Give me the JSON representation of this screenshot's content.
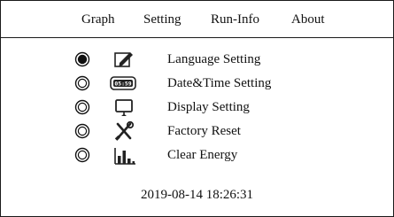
{
  "menu": {
    "items": [
      {
        "label": "Graph"
      },
      {
        "label": "Setting"
      },
      {
        "label": "Run-Info"
      },
      {
        "label": "About"
      }
    ]
  },
  "settings": {
    "items": [
      {
        "label": "Language Setting",
        "icon": "edit-icon",
        "selected": true
      },
      {
        "label": "Date&Time Setting",
        "icon": "clock-display-icon",
        "icon_text": "05:59",
        "selected": false
      },
      {
        "label": "Display Setting",
        "icon": "monitor-icon",
        "selected": false
      },
      {
        "label": "Factory Reset",
        "icon": "tools-icon",
        "selected": false
      },
      {
        "label": "Clear Energy",
        "icon": "bar-chart-icon",
        "selected": false
      }
    ]
  },
  "status": {
    "datetime": "2019-08-14 18:26:31"
  },
  "colors": {
    "foreground": "#111111",
    "background": "#ffffff"
  }
}
